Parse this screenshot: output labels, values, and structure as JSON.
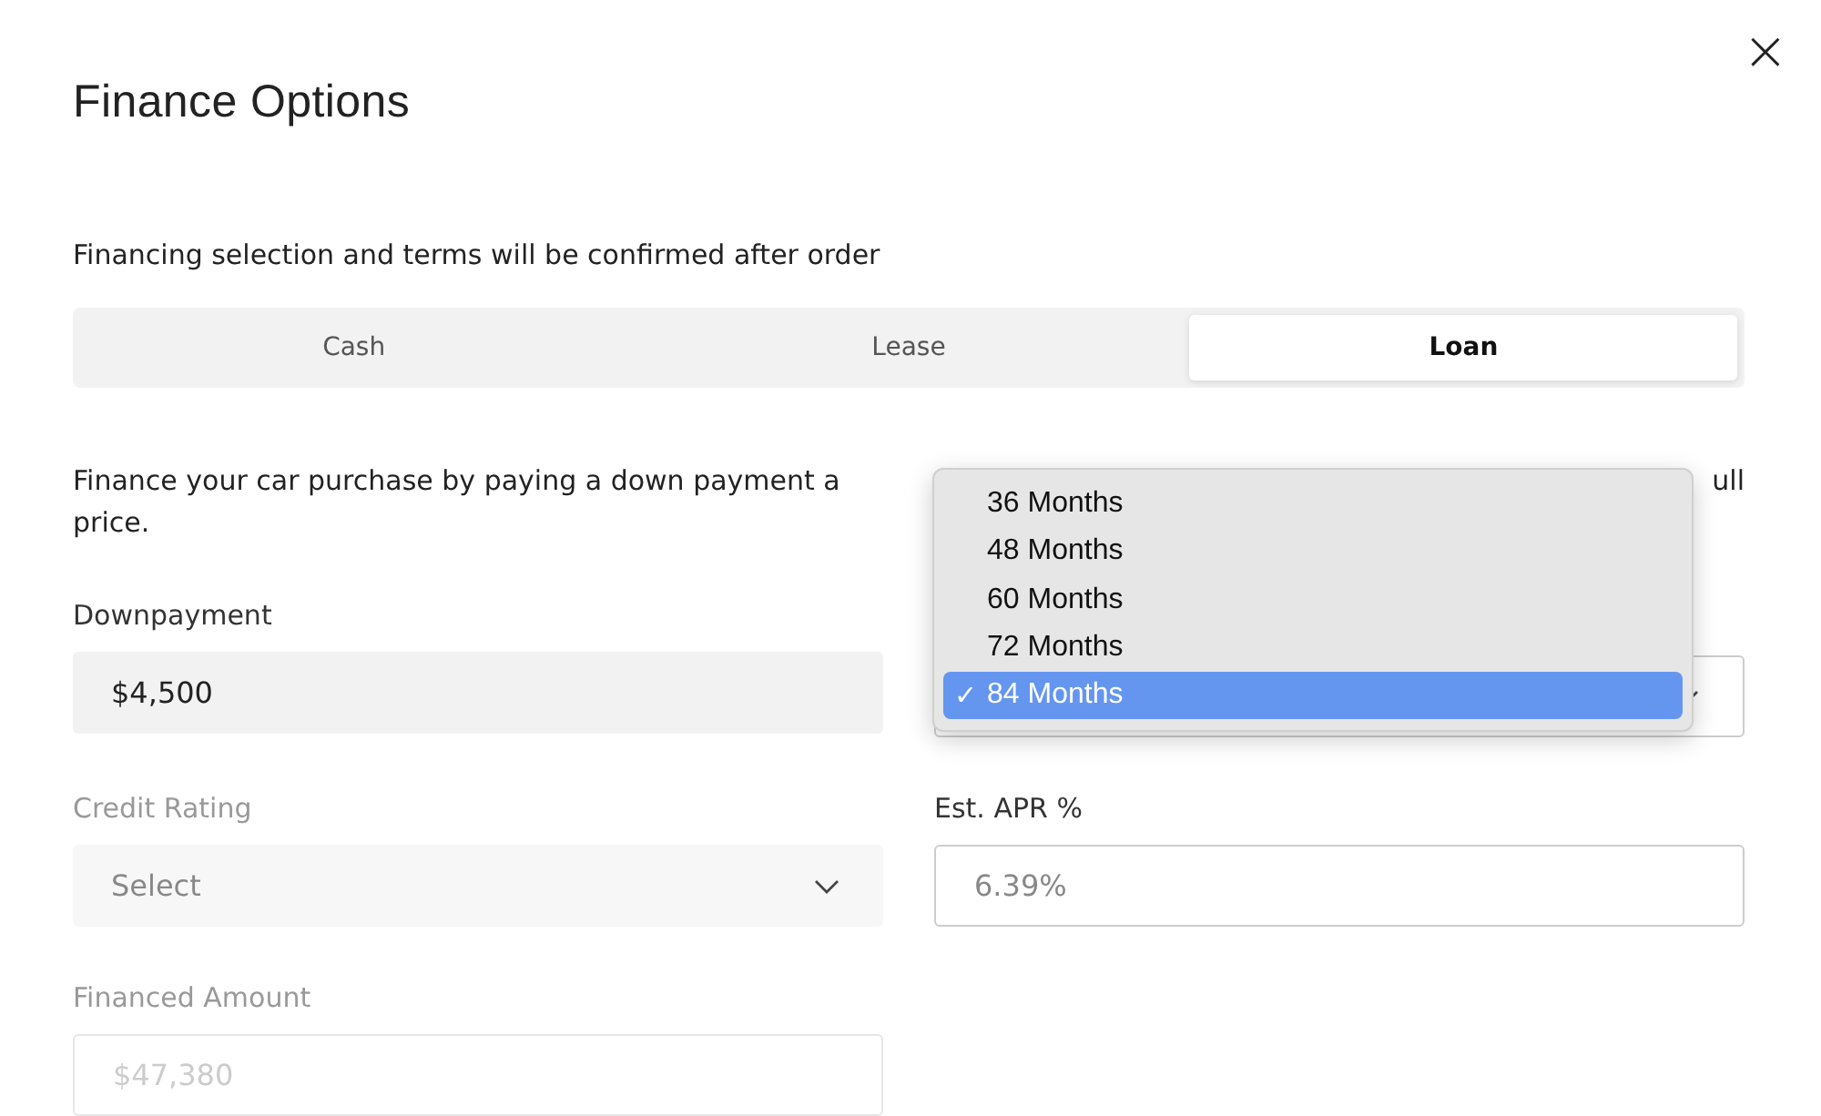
{
  "dialog": {
    "title": "Finance Options",
    "close_label": "×"
  },
  "notice": "Financing selection and terms will be confirmed after order",
  "tabs": [
    {
      "label": "Cash",
      "selected": false
    },
    {
      "label": "Lease",
      "selected": false
    },
    {
      "label": "Loan",
      "selected": true
    }
  ],
  "description": {
    "line_start": "Finance your car purchase by paying a down payment a",
    "line_end": "ull",
    "second_line": "price."
  },
  "fields": [
    {
      "kind": "text",
      "label": "Downpayment",
      "value": "$4,500",
      "disabled": false
    },
    {
      "kind": "term-select",
      "disabled": false
    },
    {
      "kind": "select",
      "label": "Credit Rating",
      "placeholder": "Select",
      "disabled": true
    },
    {
      "kind": "text",
      "label": "Est. APR %",
      "placeholder": "6.39%",
      "disabled": false
    },
    {
      "kind": "text",
      "label": "Financed Amount",
      "placeholder": "$47,380",
      "disabled": true
    }
  ],
  "term_menu": [
    {
      "label": "36 Months",
      "selected": false
    },
    {
      "label": "48 Months",
      "selected": false
    },
    {
      "label": "60 Months",
      "selected": false
    },
    {
      "label": "72 Months",
      "selected": false
    },
    {
      "label": "84 Months",
      "selected": true
    }
  ],
  "check_mark": "✓"
}
